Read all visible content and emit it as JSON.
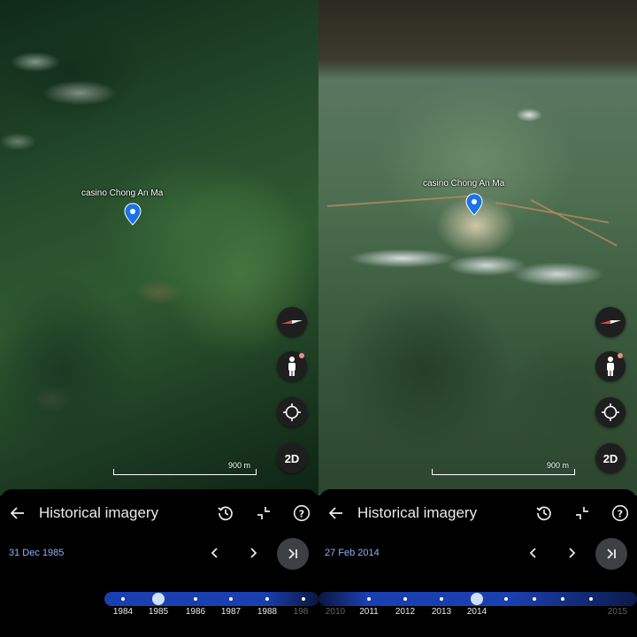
{
  "panels": [
    {
      "place_label": "casino Chong An Ma",
      "scale_label": "900 m",
      "mode_button": "2D",
      "sheet": {
        "title": "Historical imagery",
        "date": "31 Dec 1985",
        "timeline_years": [
          "1984",
          "1985",
          "1986",
          "1987",
          "1988",
          "198"
        ],
        "selected_year": "1985"
      }
    },
    {
      "place_label": "casino Chong An Ma",
      "scale_label": "900 m",
      "mode_button": "2D",
      "sheet": {
        "title": "Historical imagery",
        "date": "27 Feb 2014",
        "timeline_years": [
          "2010",
          "2011",
          "2012",
          "2013",
          "2014",
          "2015"
        ],
        "selected_year": "2014"
      }
    }
  ],
  "icons": {
    "back": "arrow-left-icon",
    "history": "history-icon",
    "minimize": "minimize-icon",
    "help": "help-icon",
    "prev": "chevron-left-icon",
    "next": "chevron-right-icon",
    "latest": "skip-to-latest-icon",
    "compass": "compass-icon",
    "street_view": "pegman-icon",
    "locate": "my-location-icon",
    "pin": "location-pin-icon"
  },
  "colors": {
    "accent": "#8ab4f8",
    "timeline": "#1a3fb0",
    "pin": "#1a73e8",
    "sheet_bg": "#000000"
  }
}
